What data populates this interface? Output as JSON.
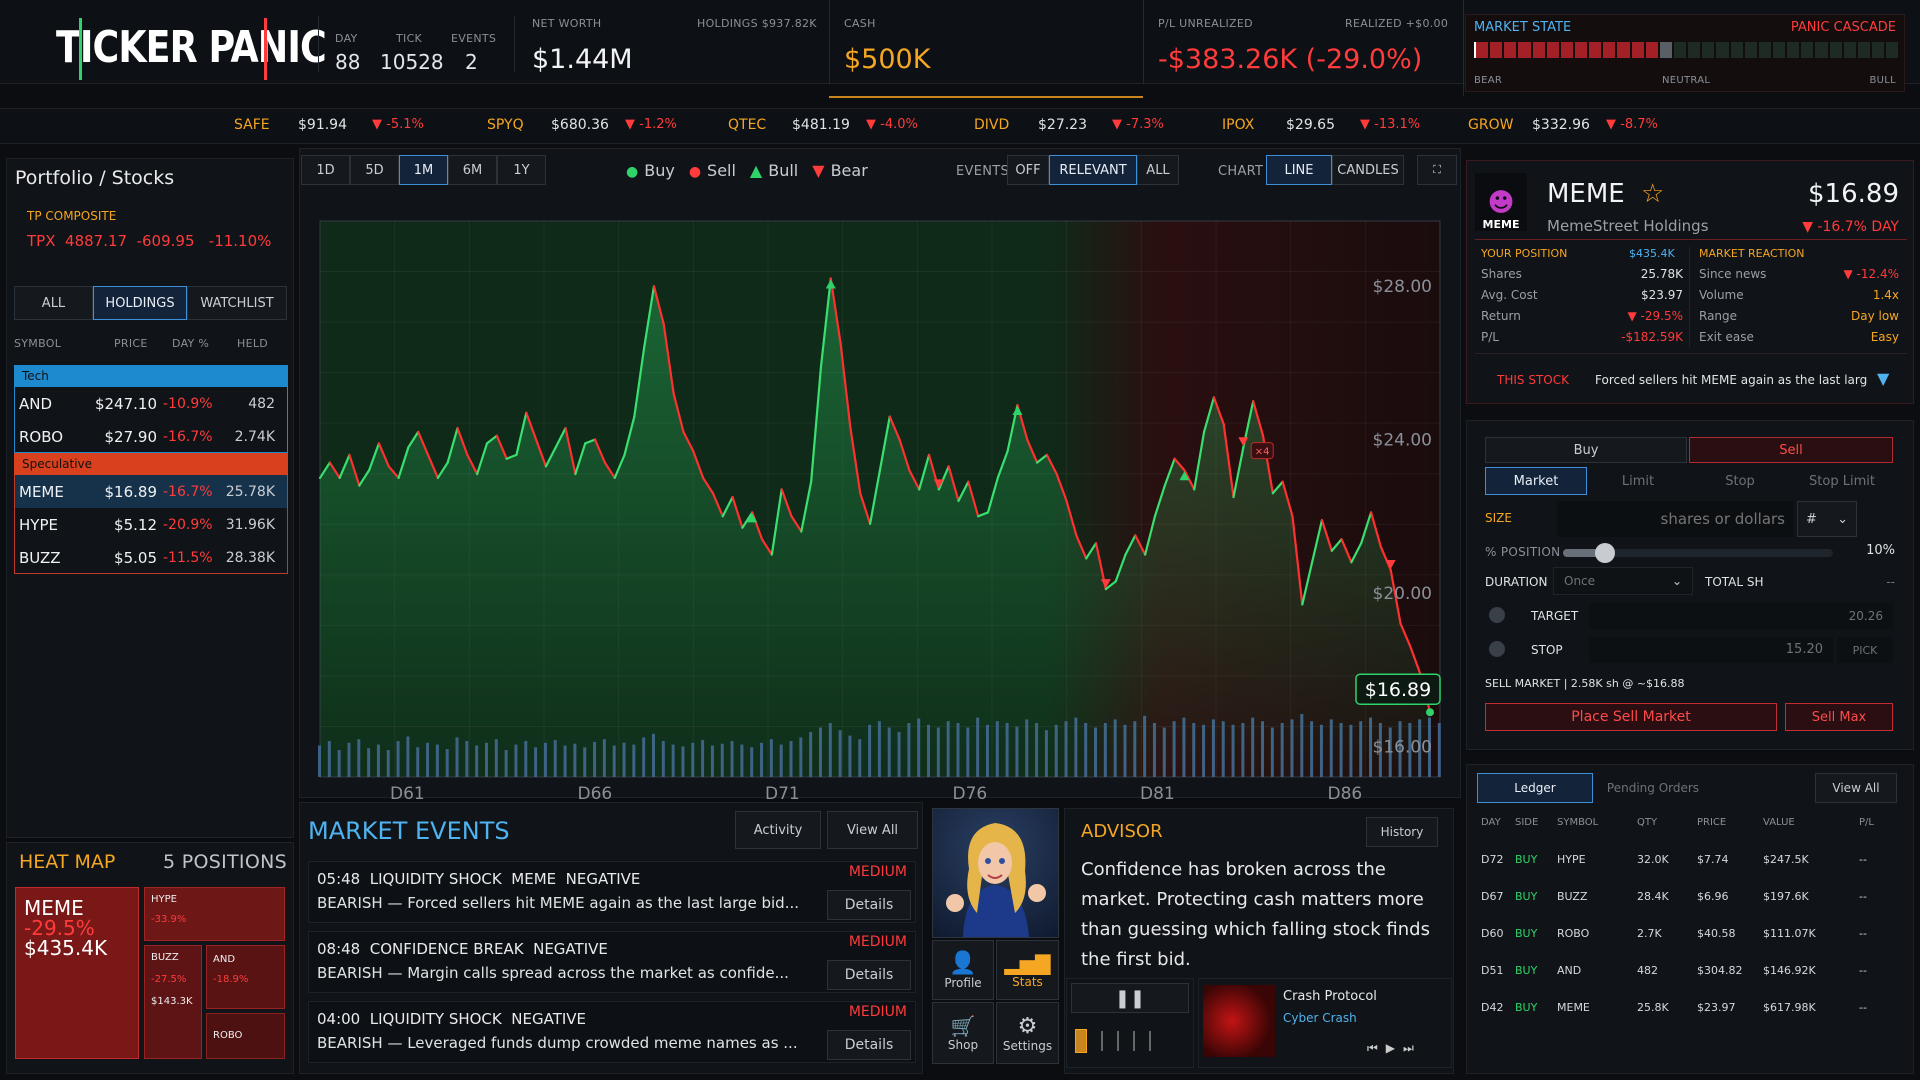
{
  "header": {
    "logo": "TICKER PANIC",
    "day_label": "DAY",
    "day": "88",
    "tick_label": "TICK",
    "tick": "10528",
    "events_label": "EVENTS",
    "events": "2",
    "networth_label": "NET WORTH",
    "networth": "$1.44M",
    "holdings_label": "HOLDINGS $937.82K",
    "cash_label": "CASH",
    "cash": "$500K",
    "pl_label": "P/L UNREALIZED",
    "realized_label": "REALIZED +$0.00",
    "pl": "-$383.26K (-29.0%)",
    "market_state_label": "MARKET STATE",
    "panic_label": "PANIC CASCADE",
    "bear": "BEAR",
    "neutral": "NEUTRAL",
    "bull": "BULL"
  },
  "ticker_strip": [
    {
      "sym": "SAFE",
      "price": "$91.94",
      "chg": "▼ -5.1%"
    },
    {
      "sym": "SPYQ",
      "price": "$680.36",
      "chg": "▼ -1.2%"
    },
    {
      "sym": "QTEC",
      "price": "$481.19",
      "chg": "▼ -4.0%"
    },
    {
      "sym": "DIVD",
      "price": "$27.23",
      "chg": "▼ -7.3%"
    },
    {
      "sym": "IPOX",
      "price": "$29.65",
      "chg": "▼ -13.1%"
    },
    {
      "sym": "GROW",
      "price": "$332.96",
      "chg": "▼ -8.7%"
    }
  ],
  "portfolio": {
    "title": "Portfolio / Stocks",
    "index_label": "TP COMPOSITE",
    "index": "TPX  4887.17  -609.95   -11.10%",
    "tabs": [
      "ALL",
      "HOLDINGS",
      "WATCHLIST"
    ],
    "cols": [
      "SYMBOL",
      "PRICE",
      "DAY %",
      "HELD"
    ],
    "groups": [
      {
        "name": "Tech",
        "rows": [
          [
            "AND",
            "$247.10",
            "-10.9%",
            "482"
          ],
          [
            "ROBO",
            "$27.90",
            "-16.7%",
            "2.74K"
          ]
        ]
      },
      {
        "name": "Speculative",
        "rows": [
          [
            "MEME",
            "$16.89",
            "-16.7%",
            "25.78K"
          ],
          [
            "HYPE",
            "$5.12",
            "-20.9%",
            "31.96K"
          ],
          [
            "BUZZ",
            "$5.05",
            "-11.5%",
            "28.38K"
          ]
        ]
      }
    ]
  },
  "heatmap": {
    "title": "HEAT MAP",
    "positions": "5 POSITIONS",
    "tiles": [
      {
        "sym": "MEME",
        "pct": "-29.5%",
        "val": "$435.4K"
      },
      {
        "sym": "HYPE",
        "pct": "-33.9%"
      },
      {
        "sym": "BUZZ",
        "pct": "-27.5%",
        "val": "$143.3K"
      },
      {
        "sym": "AND",
        "pct": "-18.9%"
      },
      {
        "sym": "ROBO"
      }
    ]
  },
  "chart_toolbar": {
    "ranges": [
      "1D",
      "5D",
      "1M",
      "6M",
      "1Y"
    ],
    "legend": [
      "Buy",
      "Sell",
      "Bull",
      "Bear"
    ],
    "events_label": "EVENTS",
    "events_opts": [
      "OFF",
      "RELEVANT",
      "ALL"
    ],
    "chart_label": "CHART",
    "chart_opts": [
      "LINE",
      "CANDLES"
    ]
  },
  "chart_data": {
    "type": "line",
    "price_label": "$16.89",
    "ylabels": [
      "$28.00",
      "$24.00",
      "$20.00",
      "$16.00"
    ],
    "xlabels": [
      "D61",
      "D66",
      "D71",
      "D76",
      "D81",
      "D86"
    ],
    "ylim": [
      15.2,
      29.7
    ],
    "badge": "×4",
    "values": [
      23.0,
      23.4,
      23.0,
      23.6,
      22.8,
      23.2,
      23.9,
      23.3,
      23.0,
      23.8,
      24.2,
      23.6,
      23.0,
      23.4,
      24.3,
      23.6,
      23.1,
      23.9,
      24.1,
      23.5,
      23.6,
      24.7,
      24.0,
      23.3,
      23.8,
      24.3,
      23.1,
      23.9,
      24.0,
      23.4,
      23.0,
      23.6,
      24.6,
      26.4,
      28.0,
      27.0,
      25.2,
      24.2,
      23.7,
      23.0,
      22.6,
      22.0,
      22.5,
      21.7,
      22.1,
      21.4,
      21.0,
      22.7,
      22.0,
      21.6,
      22.9,
      25.9,
      28.2,
      26.5,
      24.3,
      22.6,
      21.8,
      23.2,
      24.6,
      24.0,
      23.2,
      22.7,
      23.6,
      22.7,
      23.3,
      22.4,
      22.9,
      22.0,
      22.1,
      23.0,
      23.7,
      24.9,
      24.0,
      23.4,
      23.6,
      23.1,
      22.4,
      21.5,
      20.9,
      21.3,
      20.1,
      20.3,
      21.0,
      21.5,
      21.0,
      22.0,
      22.8,
      23.5,
      23.2,
      22.7,
      24.2,
      25.1,
      24.4,
      22.5,
      23.8,
      25.0,
      24.1,
      22.6,
      22.9,
      22.0,
      19.7,
      20.8,
      21.9,
      21.1,
      21.4,
      20.8,
      21.3,
      22.1,
      21.2,
      20.6,
      19.2,
      18.6,
      17.9,
      16.89
    ],
    "volume": [
      0.35,
      0.4,
      0.3,
      0.38,
      0.42,
      0.32,
      0.36,
      0.3,
      0.4,
      0.45,
      0.33,
      0.38,
      0.36,
      0.31,
      0.44,
      0.4,
      0.35,
      0.38,
      0.42,
      0.3,
      0.36,
      0.4,
      0.33,
      0.38,
      0.41,
      0.35,
      0.37,
      0.33,
      0.39,
      0.42,
      0.35,
      0.38,
      0.36,
      0.44,
      0.48,
      0.4,
      0.36,
      0.34,
      0.38,
      0.41,
      0.35,
      0.37,
      0.4,
      0.36,
      0.33,
      0.38,
      0.42,
      0.36,
      0.4,
      0.44,
      0.5,
      0.55,
      0.6,
      0.52,
      0.46,
      0.42,
      0.58,
      0.62,
      0.55,
      0.5,
      0.6,
      0.65,
      0.58,
      0.55,
      0.62,
      0.6,
      0.55,
      0.66,
      0.58,
      0.62,
      0.6,
      0.56,
      0.64,
      0.6,
      0.52,
      0.58,
      0.62,
      0.66,
      0.6,
      0.55,
      0.6,
      0.64,
      0.58,
      0.62,
      0.68,
      0.6,
      0.55,
      0.62,
      0.66,
      0.6,
      0.58,
      0.64,
      0.62,
      0.58,
      0.6,
      0.66,
      0.62,
      0.55,
      0.6,
      0.64,
      0.7,
      0.62,
      0.58,
      0.64,
      0.6,
      0.58,
      0.62,
      0.66,
      0.6,
      0.55,
      0.62,
      0.6,
      0.64,
      0.66,
      0.6
    ]
  },
  "events_panel": {
    "title": "MARKET EVENTS",
    "activity": "Activity",
    "view_all": "View All",
    "details": "Details",
    "items": [
      {
        "head": "05:48  LIQUIDITY SHOCK  MEME  NEGATIVE",
        "sev": "MEDIUM",
        "body": "BEARISH — Forced sellers hit MEME again as the last large bid..."
      },
      {
        "head": "08:48  CONFIDENCE BREAK  NEGATIVE",
        "sev": "MEDIUM",
        "body": "BEARISH — Margin calls spread across the market as confide..."
      },
      {
        "head": "04:00  LIQUIDITY SHOCK  NEGATIVE",
        "sev": "MEDIUM",
        "body": "BEARISH — Leveraged funds dump crowded meme names as ..."
      }
    ]
  },
  "nav": {
    "profile": "Profile",
    "stats": "Stats",
    "shop": "Shop",
    "settings": "Settings"
  },
  "advisor": {
    "title": "ADVISOR",
    "history": "History",
    "text": "Confidence has broken across the market. Protecting cash matters more than guessing which falling stock finds the first bid."
  },
  "music": {
    "track": "Crash Protocol",
    "artist": "Cyber Crash"
  },
  "stock": {
    "sym": "MEME",
    "logo": "MEME",
    "name": "MemeStreet Holdings",
    "price": "$16.89",
    "chg": "▼ -16.7% DAY",
    "pos_title": "YOUR POSITION",
    "pos_value": "$435.4K",
    "react_title": "MARKET REACTION",
    "pos": [
      [
        "Shares",
        "25.78K"
      ],
      [
        "Avg. Cost",
        "$23.97"
      ],
      [
        "Return",
        "▼ -29.5%"
      ],
      [
        "P/L",
        "-$182.59K"
      ]
    ],
    "react": [
      [
        "Since news",
        "▼ -12.4%"
      ],
      [
        "Volume",
        "1.4x"
      ],
      [
        "Range",
        "Day low"
      ],
      [
        "Exit ease",
        "Easy"
      ]
    ],
    "this_stock": "THIS STOCK",
    "news": "Forced sellers hit MEME again as the last larg"
  },
  "order": {
    "buy": "Buy",
    "sell": "Sell",
    "types": [
      "Market",
      "Limit",
      "Stop",
      "Stop Limit"
    ],
    "size_label": "SIZE",
    "size_placeholder": "shares or dollars",
    "unit": "#",
    "pct_label": "% POSITION",
    "pct": "10%",
    "pct_fraction": 0.1,
    "duration_label": "DURATION",
    "duration": "Once",
    "total_label": "TOTAL SH",
    "total": "--",
    "target_label": "TARGET",
    "target": "20.26",
    "stop_label": "STOP",
    "stop": "15.20",
    "pick": "PICK",
    "summary": "SELL MARKET | 2.58K sh @ ~$16.88",
    "place": "Place Sell Market",
    "sell_max": "Sell Max"
  },
  "ledger": {
    "tabs": [
      "Ledger",
      "Pending Orders"
    ],
    "view_all": "View All",
    "cols": [
      "DAY",
      "SIDE",
      "SYMBOL",
      "QTY",
      "PRICE",
      "VALUE",
      "P/L"
    ],
    "rows": [
      [
        "D72",
        "BUY",
        "HYPE",
        "32.0K",
        "$7.74",
        "$247.5K",
        "--"
      ],
      [
        "D67",
        "BUY",
        "BUZZ",
        "28.4K",
        "$6.96",
        "$197.6K",
        "--"
      ],
      [
        "D60",
        "BUY",
        "ROBO",
        "2.7K",
        "$40.58",
        "$111.07K",
        "--"
      ],
      [
        "D51",
        "BUY",
        "AND",
        "482",
        "$304.82",
        "$146.92K",
        "--"
      ],
      [
        "D42",
        "BUY",
        "MEME",
        "25.8K",
        "$23.97",
        "$617.98K",
        "--"
      ]
    ]
  }
}
